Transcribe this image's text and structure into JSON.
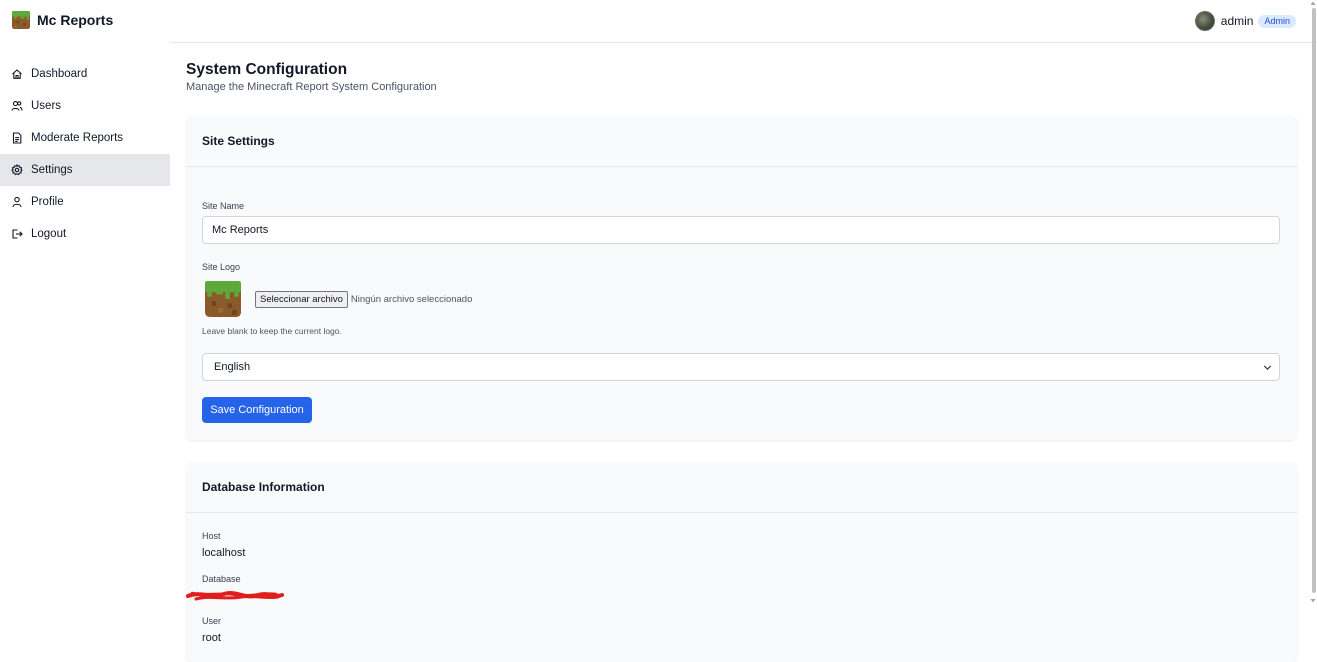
{
  "header": {
    "brand_name": "Mc Reports",
    "logo_icon": "grass-block-icon",
    "user": {
      "name": "admin",
      "role": "Admin"
    }
  },
  "sidebar": {
    "items": [
      {
        "label": "Dashboard",
        "icon": "home-icon",
        "active": false
      },
      {
        "label": "Users",
        "icon": "users-icon",
        "active": false
      },
      {
        "label": "Moderate Reports",
        "icon": "document-icon",
        "active": false
      },
      {
        "label": "Settings",
        "icon": "gear-icon",
        "active": true
      },
      {
        "label": "Profile",
        "icon": "user-icon",
        "active": false
      },
      {
        "label": "Logout",
        "icon": "logout-icon",
        "active": false
      }
    ]
  },
  "page": {
    "title": "System Configuration",
    "subtitle": "Manage the Minecraft Report System Configuration"
  },
  "site_settings": {
    "title": "Site Settings",
    "site_name_label": "Site Name",
    "site_name_value": "Mc Reports",
    "site_logo_label": "Site Logo",
    "file_button": "Seleccionar archivo",
    "file_status": "Ningún archivo seleccionado",
    "logo_help": "Leave blank to keep the current logo.",
    "language_value": "English",
    "save_button": "Save Configuration"
  },
  "database_info": {
    "title": "Database Information",
    "host_label": "Host",
    "host_value": "localhost",
    "database_label": "Database",
    "user_label": "User",
    "user_value": "root"
  },
  "colors": {
    "primary": "#2563eb",
    "active_nav": "#e5e7eb",
    "card_bg": "#f9fafb",
    "badge_bg": "#dbeafe",
    "redaction": "#e11d1d"
  }
}
